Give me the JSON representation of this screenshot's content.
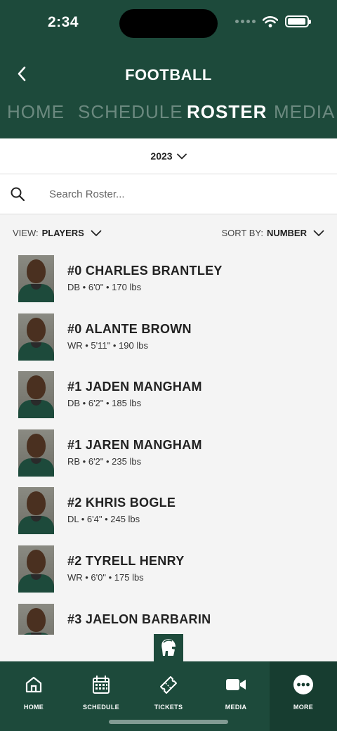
{
  "status_bar": {
    "time": "2:34",
    "battery_level": 0.95
  },
  "header": {
    "title": "FOOTBALL",
    "tabs": [
      {
        "label": "HOME",
        "active": false
      },
      {
        "label": "SCHEDULE",
        "active": false
      },
      {
        "label": "ROSTER",
        "active": true
      },
      {
        "label": "MEDIA",
        "active": false
      }
    ]
  },
  "season": {
    "selected": "2023"
  },
  "search": {
    "placeholder": "Search Roster...",
    "value": ""
  },
  "filters": {
    "view_label": "VIEW:",
    "view_value": "PLAYERS",
    "sort_label": "SORT BY:",
    "sort_value": "NUMBER"
  },
  "players": [
    {
      "name": "#0 CHARLES BRANTLEY",
      "details": "DB • 6'0\" • 170 lbs"
    },
    {
      "name": "#0 ALANTE BROWN",
      "details": "WR • 5'11\" • 190 lbs"
    },
    {
      "name": "#1 JADEN MANGHAM",
      "details": "DB • 6'2\" • 185 lbs"
    },
    {
      "name": "#1 JAREN MANGHAM",
      "details": "RB • 6'2\" • 235 lbs"
    },
    {
      "name": "#2 KHRIS BOGLE",
      "details": "DL • 6'4\" • 245 lbs"
    },
    {
      "name": "#2 TYRELL HENRY",
      "details": "WR • 6'0\" • 175 lbs"
    },
    {
      "name": "#3 JAELON BARBARIN",
      "details": ""
    }
  ],
  "bottom_nav": [
    {
      "label": "HOME",
      "icon": "home-icon",
      "active": false
    },
    {
      "label": "SCHEDULE",
      "icon": "calendar-icon",
      "active": false
    },
    {
      "label": "TICKETS",
      "icon": "ticket-icon",
      "active": false
    },
    {
      "label": "MEDIA",
      "icon": "video-camera-icon",
      "active": false
    },
    {
      "label": "MORE",
      "icon": "more-dots-icon",
      "active": true
    }
  ],
  "colors": {
    "brand_green": "#1d4a3b",
    "brand_green_dark": "#173d30",
    "background": "#f4f4f4"
  }
}
